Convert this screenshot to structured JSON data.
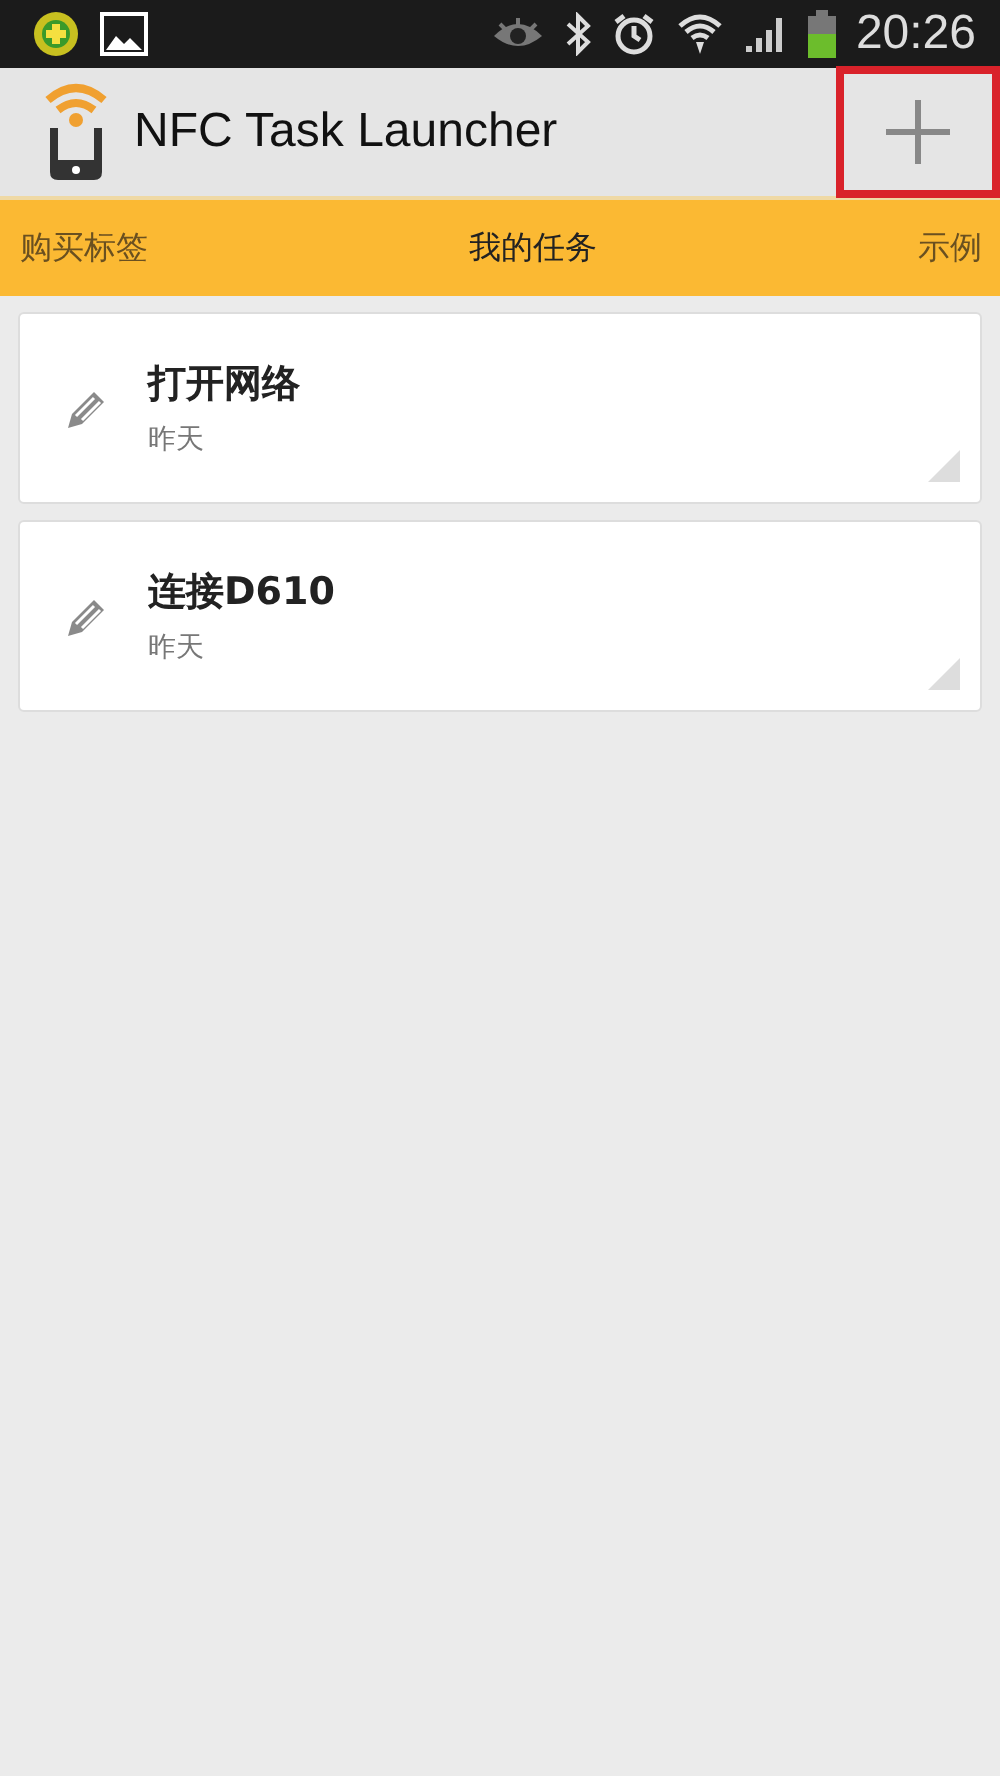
{
  "status_bar": {
    "time": "20:26"
  },
  "action_bar": {
    "title": "NFC Task Launcher",
    "add_button": {
      "highlighted": true
    }
  },
  "tabs": [
    {
      "label": "购买标签",
      "selected": false
    },
    {
      "label": "我的任务",
      "selected": true
    },
    {
      "label": "示例",
      "selected": false
    }
  ],
  "tasks": [
    {
      "name": "打开网络",
      "date": "昨天"
    },
    {
      "name": "连接D610",
      "date": "昨天"
    }
  ]
}
